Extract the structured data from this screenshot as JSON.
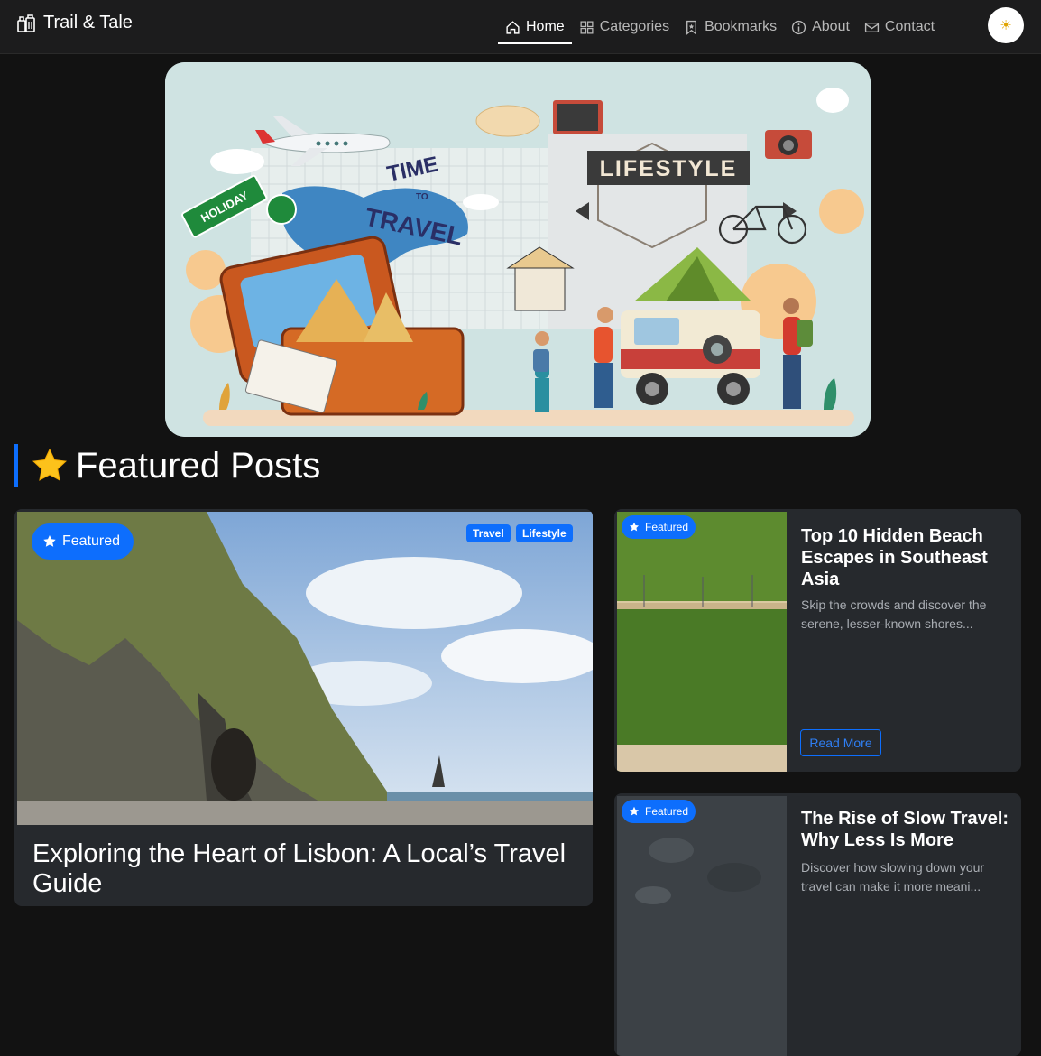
{
  "brand": {
    "name": "Trail & Tale"
  },
  "nav": {
    "items": [
      {
        "label": "Home",
        "icon": "house-icon",
        "active": true
      },
      {
        "label": "Categories",
        "icon": "grid-icon"
      },
      {
        "label": "Bookmarks",
        "icon": "bookmark-icon"
      },
      {
        "label": "About",
        "icon": "info-icon"
      },
      {
        "label": "Contact",
        "icon": "envelope-icon"
      }
    ],
    "theme_toggle": "☀"
  },
  "hero": {
    "holiday": "HOLIDAY",
    "time_to_travel_1": "TIME",
    "time_to_travel_2": "TO",
    "time_to_travel_3": "TRAVEL",
    "lifestyle": "LIFESTYLE"
  },
  "section": {
    "title": "Featured Posts"
  },
  "posts": {
    "main": {
      "badge": "Featured",
      "tags": [
        "Travel",
        "Lifestyle"
      ],
      "title": "Exploring the Heart of Lisbon: A Local’s Travel Guide"
    },
    "side1": {
      "badge": "Featured",
      "title": "Top 10 Hidden Beach Escapes in Southeast Asia",
      "excerpt": "Skip the crowds and discover the serene, lesser-known shores...",
      "button": "Read More"
    },
    "side2": {
      "badge": "Featured",
      "title": "The Rise of Slow Travel: Why Less Is More",
      "excerpt": "Discover how slowing down your travel can make it more meani..."
    }
  },
  "colors": {
    "accent": "#0d6efd",
    "bg": "#121212",
    "card": "#26292d"
  }
}
